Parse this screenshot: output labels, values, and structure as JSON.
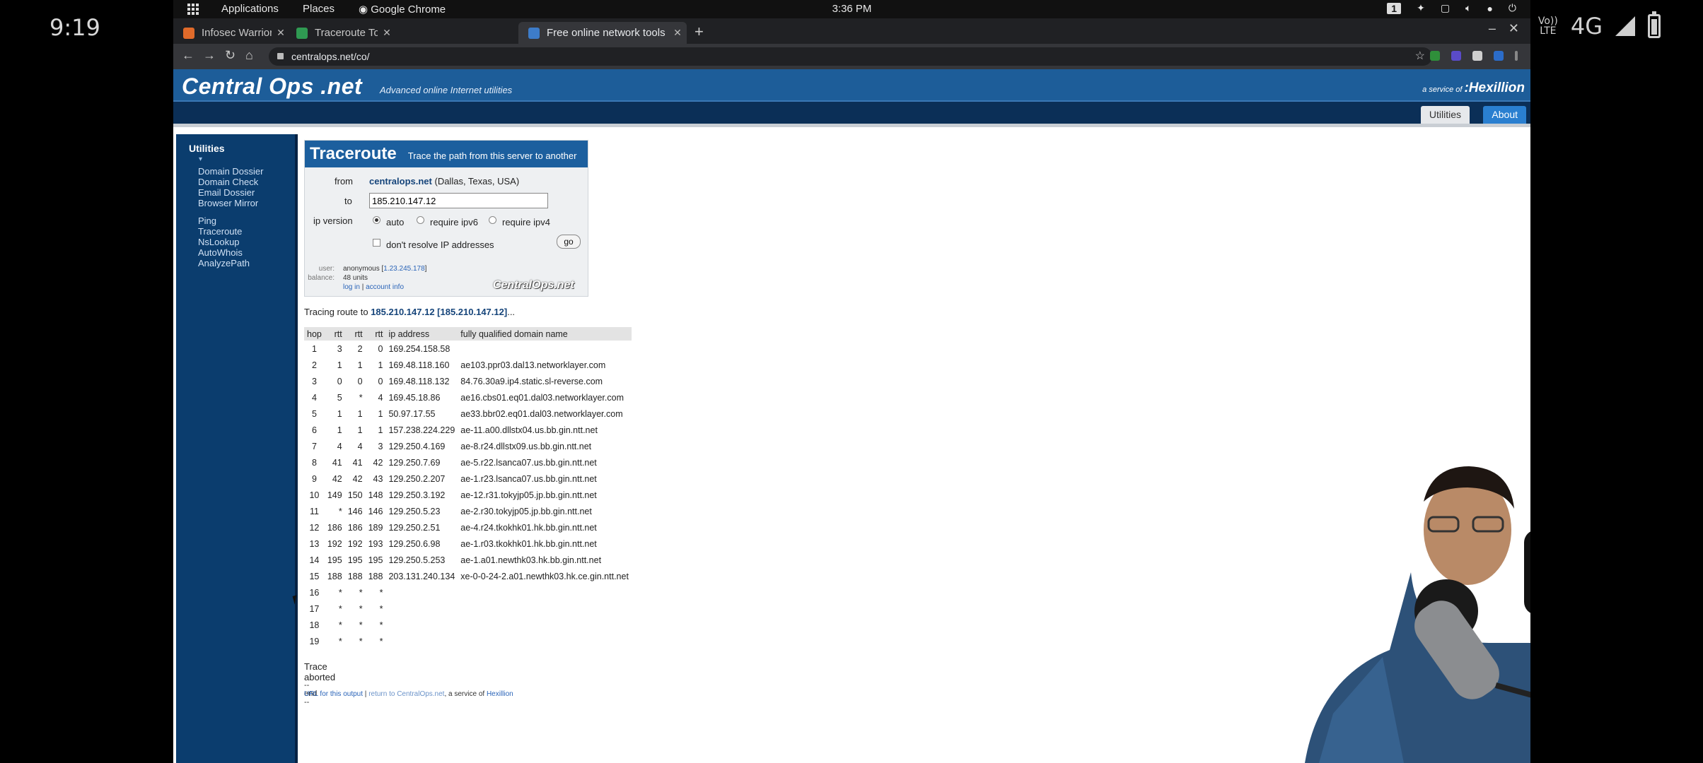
{
  "phone": {
    "time": "9:19",
    "network": "4G",
    "volte": [
      "Vo))",
      "LTE"
    ]
  },
  "gnome": {
    "menu_applications": "Applications",
    "menu_places": "Places",
    "menu_app": "Google Chrome",
    "clock": "3:36 PM",
    "workspace": "1"
  },
  "browser": {
    "tabs": [
      {
        "label": "Infosec Warrior | Vulnerab",
        "favicon_color": "#e06a2a"
      },
      {
        "label": "Traceroute Tool - ViewDN",
        "favicon_color": "#2f9a52"
      },
      {
        "label": "Free online network tools",
        "favicon_color": "#3d7cc9"
      }
    ],
    "url": "centralops.net/co/"
  },
  "site": {
    "logo": "Central Ops .net",
    "tagline": "Advanced online Internet utilities",
    "service_prefix": "a service of",
    "service_brand": ":Hexillion",
    "tab_utilities": "Utilities",
    "tab_about": "About"
  },
  "sidebar": {
    "heading": "Utilities",
    "group1": [
      "Domain Dossier",
      "Domain Check",
      "Email Dossier",
      "Browser Mirror"
    ],
    "group2": [
      "Ping",
      "Traceroute",
      "NsLookup",
      "AutoWhois",
      "AnalyzePath"
    ]
  },
  "form": {
    "title": "Traceroute",
    "subtitle": "Trace the path from this server to another",
    "from_label": "from",
    "from_host": "centralops.net",
    "from_location": "(Dallas, Texas, USA)",
    "to_label": "to",
    "to_value": "185.210.147.12",
    "ipv_label": "ip version",
    "opt_auto": "auto",
    "opt_ipv6": "require ipv6",
    "opt_ipv4": "require ipv4",
    "no_resolve": "don't resolve IP addresses",
    "go": "go",
    "user_label": "user:",
    "user_value": "anonymous [",
    "user_ip": "1.23.245.178",
    "user_close": "]",
    "balance_label": "balance:",
    "balance_value": "48 units",
    "login": "log in",
    "sep": "|",
    "account": "account info",
    "box_logo": "CentralOps.net"
  },
  "result": {
    "tracing_prefix": "Tracing route to",
    "tracing_target": "185.210.147.12 [185.210.147.12]",
    "tracing_suffix": "...",
    "headers": [
      "hop",
      "rtt",
      "rtt",
      "rtt",
      "ip address",
      "fully qualified domain name"
    ],
    "hops": [
      [
        "1",
        "3",
        "2",
        "0",
        "169.254.158.58",
        ""
      ],
      [
        "2",
        "1",
        "1",
        "1",
        "169.48.118.160",
        "ae103.ppr03.dal13.networklayer.com"
      ],
      [
        "3",
        "0",
        "0",
        "0",
        "169.48.118.132",
        "84.76.30a9.ip4.static.sl-reverse.com"
      ],
      [
        "4",
        "5",
        "*",
        "4",
        "169.45.18.86",
        "ae16.cbs01.eq01.dal03.networklayer.com"
      ],
      [
        "5",
        "1",
        "1",
        "1",
        "50.97.17.55",
        "ae33.bbr02.eq01.dal03.networklayer.com"
      ],
      [
        "6",
        "1",
        "1",
        "1",
        "157.238.224.229",
        "ae-11.a00.dllstx04.us.bb.gin.ntt.net"
      ],
      [
        "7",
        "4",
        "4",
        "3",
        "129.250.4.169",
        "ae-8.r24.dllstx09.us.bb.gin.ntt.net"
      ],
      [
        "8",
        "41",
        "41",
        "42",
        "129.250.7.69",
        "ae-5.r22.lsanca07.us.bb.gin.ntt.net"
      ],
      [
        "9",
        "42",
        "42",
        "43",
        "129.250.2.207",
        "ae-1.r23.lsanca07.us.bb.gin.ntt.net"
      ],
      [
        "10",
        "149",
        "150",
        "148",
        "129.250.3.192",
        "ae-12.r31.tokyjp05.jp.bb.gin.ntt.net"
      ],
      [
        "11",
        "*",
        "146",
        "146",
        "129.250.5.23",
        "ae-2.r30.tokyjp05.jp.bb.gin.ntt.net"
      ],
      [
        "12",
        "186",
        "186",
        "189",
        "129.250.2.51",
        "ae-4.r24.tkokhk01.hk.bb.gin.ntt.net"
      ],
      [
        "13",
        "192",
        "192",
        "193",
        "129.250.6.98",
        "ae-1.r03.tkokhk01.hk.bb.gin.ntt.net"
      ],
      [
        "14",
        "195",
        "195",
        "195",
        "129.250.5.253",
        "ae-1.a01.newthk03.hk.bb.gin.ntt.net"
      ],
      [
        "15",
        "188",
        "188",
        "188",
        "203.131.240.134",
        "xe-0-0-24-2.a01.newthk03.hk.ce.gin.ntt.net"
      ],
      [
        "16",
        "*",
        "*",
        "*",
        "",
        ""
      ],
      [
        "17",
        "*",
        "*",
        "*",
        "",
        ""
      ],
      [
        "18",
        "*",
        "*",
        "*",
        "",
        ""
      ],
      [
        "19",
        "*",
        "*",
        "*",
        "",
        ""
      ]
    ],
    "aborted": "Trace aborted",
    "end": "-- end --",
    "url_link": "URL for this output",
    "divider": "|",
    "return_link": "return to CentralOps.net",
    "service_text": ", a service of",
    "hexillion_link": "Hexillion"
  },
  "colors": {
    "header_blue": "#1d5d99",
    "nav_dark": "#0b2f57",
    "sidebar": "#0b3d6e",
    "link": "#2a64b8"
  }
}
